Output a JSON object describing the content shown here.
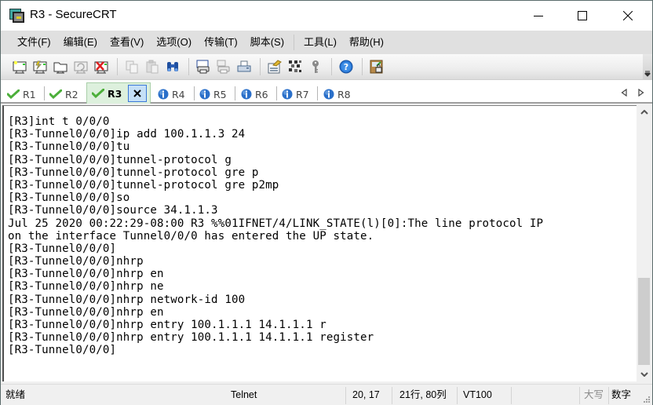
{
  "window": {
    "title": "R3 - SecureCRT",
    "controls": {
      "minimize": "minimize",
      "maximize": "maximize",
      "close": "close"
    }
  },
  "menu": {
    "items": [
      "文件(F)",
      "编辑(E)",
      "查看(V)",
      "选项(O)",
      "传输(T)",
      "脚本(S)",
      "工具(L)",
      "帮助(H)"
    ]
  },
  "toolbar": {
    "buttons": [
      {
        "icon": "quick-connect-icon",
        "tooltip": "Quick Connect"
      },
      {
        "icon": "connect-in-tab-icon",
        "tooltip": "Connect in Tab"
      },
      {
        "icon": "connect-icon",
        "tooltip": "Connect"
      },
      {
        "icon": "reconnect-icon",
        "tooltip": "Reconnect"
      },
      {
        "icon": "disconnect-icon",
        "tooltip": "Disconnect"
      },
      {
        "icon": "copy-icon",
        "tooltip": "Copy"
      },
      {
        "icon": "paste-icon",
        "tooltip": "Paste"
      },
      {
        "icon": "find-icon",
        "tooltip": "Find"
      },
      {
        "icon": "print-screen-icon",
        "tooltip": "Print Screen"
      },
      {
        "icon": "print-selection-icon",
        "tooltip": "Print Selection"
      },
      {
        "icon": "print-icon",
        "tooltip": "Print"
      },
      {
        "icon": "session-options-icon",
        "tooltip": "Session Options"
      },
      {
        "icon": "keymap-icon",
        "tooltip": "Keymap"
      },
      {
        "icon": "key-icon",
        "tooltip": "Public Key"
      },
      {
        "icon": "help-icon",
        "tooltip": "Help"
      },
      {
        "icon": "sftp-icon",
        "tooltip": "SFTP"
      }
    ]
  },
  "tabs": [
    {
      "label": "R1",
      "status": "connected",
      "active": false
    },
    {
      "label": "R2",
      "status": "connected",
      "active": false
    },
    {
      "label": "R3",
      "status": "connected",
      "active": true
    },
    {
      "label": "R4",
      "status": "disconnected",
      "active": false
    },
    {
      "label": "R5",
      "status": "disconnected",
      "active": false
    },
    {
      "label": "R6",
      "status": "disconnected",
      "active": false
    },
    {
      "label": "R7",
      "status": "disconnected",
      "active": false
    },
    {
      "label": "R8",
      "status": "disconnected",
      "active": false
    }
  ],
  "terminal": {
    "lines": [
      "[R3]int t 0/0/0",
      "[R3-Tunnel0/0/0]ip add 100.1.1.3 24",
      "[R3-Tunnel0/0/0]tu",
      "[R3-Tunnel0/0/0]tunnel-protocol g",
      "[R3-Tunnel0/0/0]tunnel-protocol gre p",
      "[R3-Tunnel0/0/0]tunnel-protocol gre p2mp",
      "[R3-Tunnel0/0/0]so",
      "[R3-Tunnel0/0/0]source 34.1.1.3",
      "Jul 25 2020 00:22:29-08:00 R3 %%01IFNET/4/LINK_STATE(l)[0]:The line protocol IP",
      "on the interface Tunnel0/0/0 has entered the UP state.",
      "[R3-Tunnel0/0/0]",
      "[R3-Tunnel0/0/0]nhrp",
      "[R3-Tunnel0/0/0]nhrp en",
      "[R3-Tunnel0/0/0]nhrp ne",
      "[R3-Tunnel0/0/0]nhrp network-id 100",
      "[R3-Tunnel0/0/0]nhrp en",
      "[R3-Tunnel0/0/0]nhrp entry 100.1.1.1 14.1.1.1 r",
      "[R3-Tunnel0/0/0]nhrp entry 100.1.1.1 14.1.1.1 register",
      "[R3-Tunnel0/0/0]"
    ]
  },
  "statusbar": {
    "status": "就绪",
    "protocol": "Telnet",
    "cursor": "20,  17",
    "size": "21行, 80列",
    "emulation": "VT100",
    "caps": "大写",
    "num": "数字"
  },
  "colors": {
    "connected": "#4caf3a",
    "disconnected": "#2a6fc9",
    "active_tab_bg": "#ddf0dd",
    "close_btn_bg": "#c5e0f7"
  }
}
